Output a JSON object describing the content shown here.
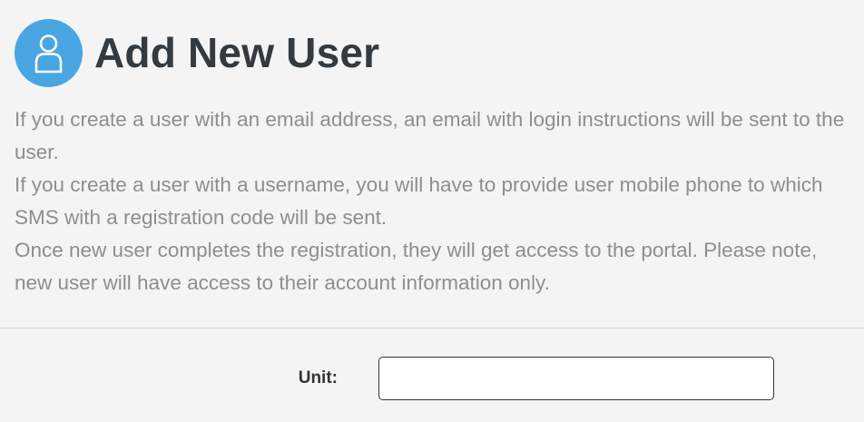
{
  "header": {
    "icon": "user-icon",
    "icon_background": "#4aa6e2",
    "title": "Add New User"
  },
  "instructions": {
    "paragraphs": [
      "If you create a user with an email address, an email with login instructions will be sent to the user.",
      "If you create a user with a username, you will have to provide user mobile phone to which SMS with a registration code will be sent.",
      "Once new user completes the registration, they will get access to the portal. Please note, new user will have access to their account information only."
    ]
  },
  "form": {
    "unit": {
      "label": "Unit:",
      "value": "",
      "placeholder": ""
    }
  }
}
